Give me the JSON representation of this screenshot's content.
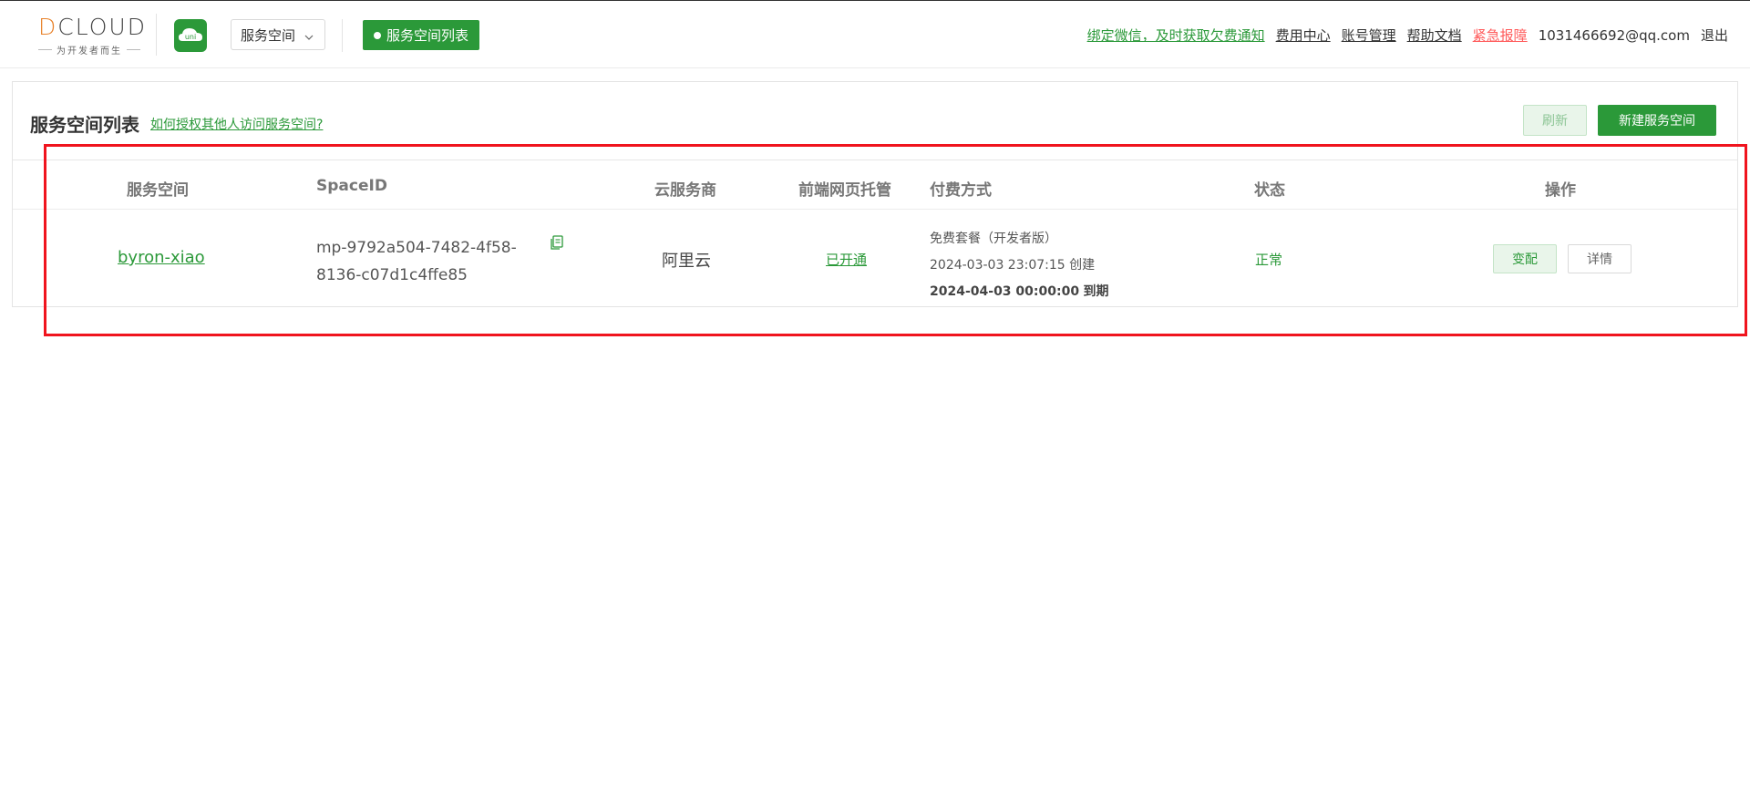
{
  "header": {
    "logo": {
      "brand": "DCLOUD",
      "tagline": "为开发者而生"
    },
    "uni_icon_label": "uni",
    "space_select": {
      "value": "服务空间"
    },
    "list_button_label": "服务空间列表",
    "links": {
      "bind_wechat": "绑定微信，及时获取欠费通知",
      "billing": "费用中心",
      "account": "账号管理",
      "help": "帮助文档",
      "emergency": "紧急报障",
      "user_email": "1031466692@qq.com",
      "logout": "退出"
    }
  },
  "main": {
    "title": "服务空间列表",
    "help_link": "如何授权其他人访问服务空间?",
    "refresh_button": "刷新",
    "new_button": "新建服务空间",
    "table": {
      "columns": [
        "服务空间",
        "SpaceID",
        "云服务商",
        "前端网页托管",
        "付费方式",
        "状态",
        "操作"
      ],
      "rows": [
        {
          "name": "byron-xiao",
          "space_id_line1": "mp-9792a504-7482-4f58-",
          "space_id_line2": "8136-c07d1c4ffe85",
          "provider": "阿里云",
          "hosting": "已开通",
          "pay_plan": "免费套餐（开发者版）",
          "pay_created_time": "2024-03-03 23:07:15",
          "pay_created_suffix": "创建",
          "pay_expire_time": "2024-04-03 00:00:00",
          "pay_expire_suffix": "到期",
          "status": "正常",
          "action_change": "变配",
          "action_detail": "详情"
        }
      ]
    }
  },
  "colors": {
    "brand_green": "#2b9939",
    "logo_orange": "#e8822b",
    "alert_red": "#ff5c5c",
    "highlight_red": "#f0141e"
  },
  "icons": [
    "chevron-down-icon",
    "copy-icon",
    "uni-cloud-icon"
  ]
}
